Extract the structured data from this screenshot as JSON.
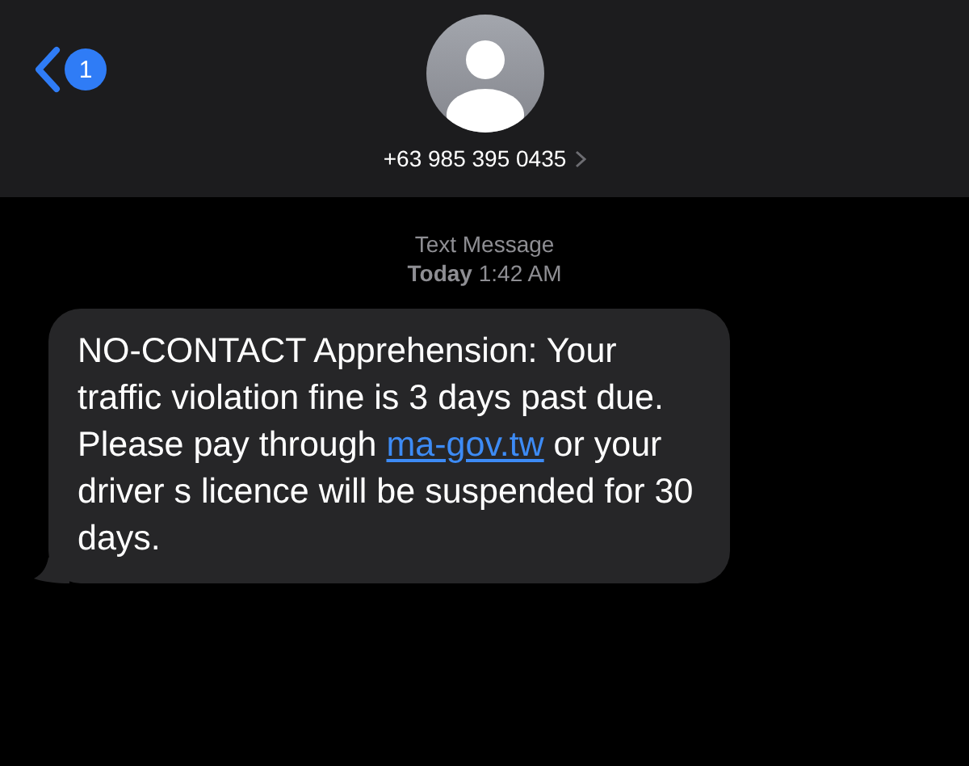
{
  "header": {
    "back_badge": "1",
    "contact": "+63 985 395 0435"
  },
  "timestamp": {
    "service": "Text Message",
    "day": "Today",
    "time": "1:42 AM"
  },
  "message": {
    "paragraph_1": "NO-CONTACT Apprehension: Your traffic violation fine is 3 days past due.",
    "paragraph_2_before": "Please pay through ",
    "link": "ma-gov.tw",
    "paragraph_2_after": " or your driver s licence will be suspended for 30 days."
  }
}
